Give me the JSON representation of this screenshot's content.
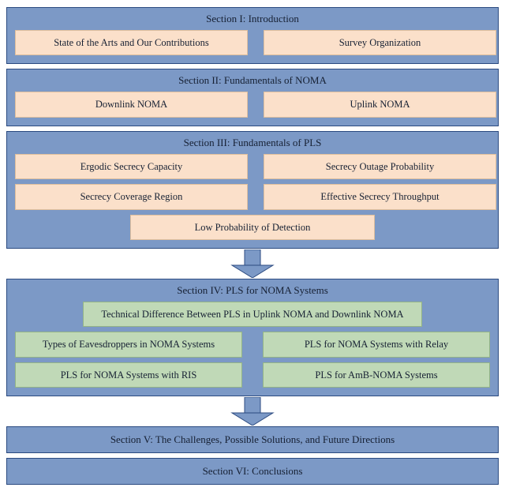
{
  "section1": {
    "title": "Section I: Introduction",
    "items": [
      "State of the Arts and Our Contributions",
      "Survey Organization"
    ]
  },
  "section2": {
    "title": "Section II: Fundamentals of NOMA",
    "items": [
      "Downlink NOMA",
      "Uplink NOMA"
    ]
  },
  "section3": {
    "title": "Section III: Fundamentals of PLS",
    "row1": [
      "Ergodic Secrecy Capacity",
      "Secrecy Outage Probability"
    ],
    "row2": [
      "Secrecy Coverage Region",
      "Effective Secrecy Throughput"
    ],
    "center": "Low Probability of Detection"
  },
  "section4": {
    "title": "Section IV: PLS for NOMA Systems",
    "top": "Technical Difference Between PLS in Uplink NOMA and Downlink NOMA",
    "row1": [
      "Types of Eavesdroppers in NOMA Systems",
      "PLS for NOMA Systems with Relay"
    ],
    "row2": [
      "PLS for NOMA Systems with RIS",
      "PLS for AmB-NOMA Systems"
    ]
  },
  "section5": "Section V: The Challenges, Possible Solutions, and Future Directions",
  "section6": "Section VI: Conclusions"
}
